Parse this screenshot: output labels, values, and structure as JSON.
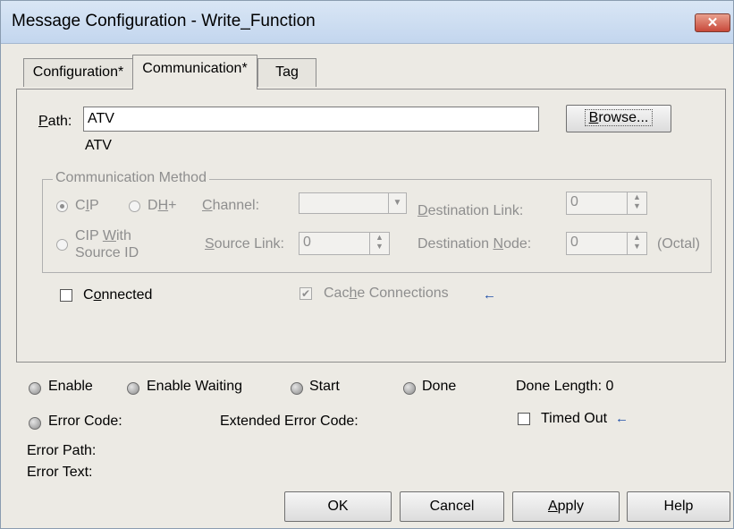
{
  "window": {
    "title": "Message Configuration - Write_Function",
    "close_glyph": "✕"
  },
  "tabs": [
    {
      "label": "Configuration*"
    },
    {
      "label": "Communication*"
    },
    {
      "label": "Tag"
    }
  ],
  "path": {
    "label_hotkey": "P",
    "label_rest": "ath:",
    "value": "ATV",
    "resolved": "ATV",
    "browse_hotkey": "B",
    "browse_rest": "rowse..."
  },
  "comm_method": {
    "group_label": "Communication Method",
    "cip": {
      "prefix": "C",
      "hotkey": "I",
      "suffix": "P",
      "selected": true
    },
    "dh": {
      "prefix": "D",
      "hotkey": "H",
      "suffix": "+"
    },
    "cip_with": {
      "line1_prefix": "CIP ",
      "line1_hotkey": "W",
      "line1_suffix": "ith",
      "line2": "Source ID"
    },
    "channel_label_hotkey": "C",
    "channel_label_rest": "hannel:",
    "channel_value": "",
    "dest_link_label_hotkey": "D",
    "dest_link_label_rest": "estination Link:",
    "dest_link_value": "0",
    "source_link_label_hotkey": "S",
    "source_link_label_rest": "ource Link:",
    "source_link_value": "0",
    "dest_node_label_prefix": "Destination ",
    "dest_node_label_hotkey": "N",
    "dest_node_label_rest": "ode:",
    "dest_node_value": "0",
    "octal_label": "(Octal)"
  },
  "options": {
    "connected_prefix": "C",
    "connected_hotkey": "o",
    "connected_rest": "nnected",
    "connected_checked": false,
    "cache_prefix": "Cac",
    "cache_hotkey": "h",
    "cache_rest": "e Connections",
    "cache_checked": true,
    "arrow_glyph": "←"
  },
  "status": {
    "enable": "Enable",
    "enable_waiting": "Enable Waiting",
    "start": "Start",
    "done": "Done",
    "done_length": "Done Length: 0",
    "error_code": "Error Code:",
    "extended_error_code": "Extended Error Code:",
    "timed_out": "Timed Out",
    "timed_out_checked": false,
    "error_path": "Error Path:",
    "error_text": "Error Text:"
  },
  "buttons": {
    "ok": "OK",
    "cancel": "Cancel",
    "apply_hotkey": "A",
    "apply_rest": "pply",
    "help": "Help"
  }
}
